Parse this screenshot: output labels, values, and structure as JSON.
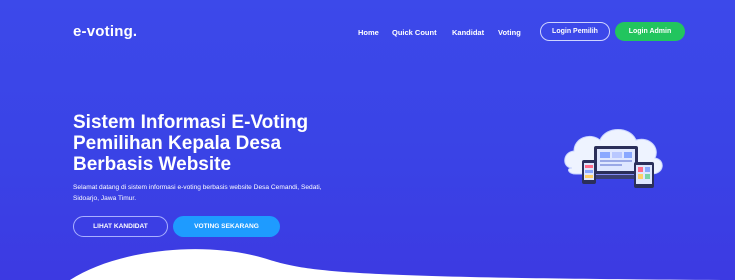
{
  "brand": {
    "name": "e-voting."
  },
  "nav": {
    "items": [
      "Home",
      "Quick Count",
      "Kandidat",
      "Voting"
    ],
    "login_pemilih": "Login Pemilih",
    "login_admin": "Login Admin"
  },
  "hero": {
    "title_part1": "Sistem Informasi ",
    "title_highlight": "E-Voting",
    "title_part2": "Pemilihan Kepala Desa Berbasis Website",
    "subtitle": "Selamat datang di sistem informasi e-voting berbasis website Desa Cemandi, Sedati, Sidoarjo, Jawa Timur.",
    "btn_kandidat": "LIHAT KANDIDAT",
    "btn_voting": "VOTING SEKARANG"
  },
  "colors": {
    "hero_bg": "#3c49ea",
    "accent_green": "#22c55e",
    "accent_blue": "#1e9bff"
  },
  "icons": {
    "illustration": "devices-cloud-illustration"
  }
}
